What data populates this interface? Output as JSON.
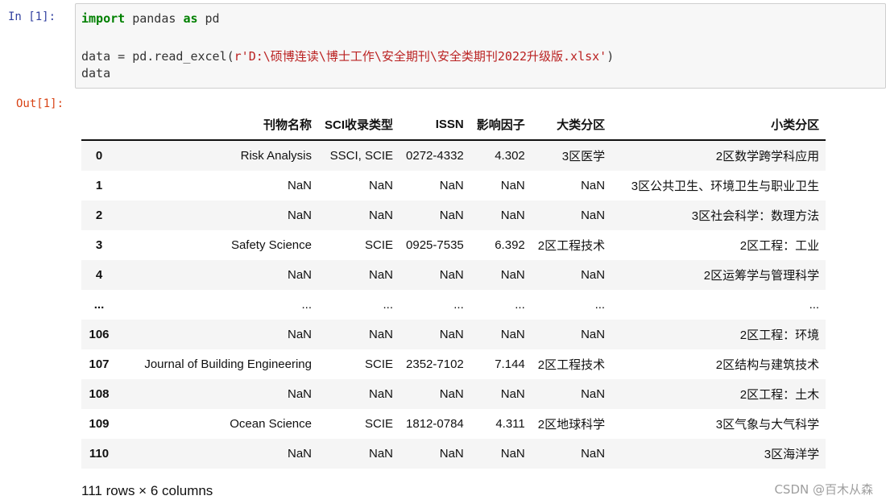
{
  "notebook": {
    "in_prompt": "In  [1]:",
    "out_prompt": "Out[1]:",
    "code": {
      "line1": {
        "kw1": "import",
        "mid": " pandas ",
        "kw2": "as",
        "end": " pd"
      },
      "line2": {
        "pre": "data = pd.read_excel(",
        "str": "r'D:\\硕博连读\\博士工作\\安全期刊\\安全类期刊2022升级版.xlsx'",
        "post": ")"
      },
      "line3": "data"
    }
  },
  "dataframe": {
    "columns": [
      "刊物名称",
      "SCI收录类型",
      "ISSN",
      "影响因子",
      "大类分区",
      "小类分区"
    ],
    "rows": [
      {
        "index": "0",
        "cells": [
          "Risk Analysis",
          "SSCI, SCIE",
          "0272-4332",
          "4.302",
          "3区医学",
          "2区数学跨学科应用"
        ]
      },
      {
        "index": "1",
        "cells": [
          "NaN",
          "NaN",
          "NaN",
          "NaN",
          "NaN",
          "3区公共卫生、环境卫生与职业卫生"
        ]
      },
      {
        "index": "2",
        "cells": [
          "NaN",
          "NaN",
          "NaN",
          "NaN",
          "NaN",
          "3区社会科学：数理方法"
        ]
      },
      {
        "index": "3",
        "cells": [
          "Safety Science",
          "SCIE",
          "0925-7535",
          "6.392",
          "2区工程技术",
          "2区工程：工业"
        ]
      },
      {
        "index": "4",
        "cells": [
          "NaN",
          "NaN",
          "NaN",
          "NaN",
          "NaN",
          "2区运筹学与管理科学"
        ]
      },
      {
        "index": "...",
        "cells": [
          "...",
          "...",
          "...",
          "...",
          "...",
          "..."
        ]
      },
      {
        "index": "106",
        "cells": [
          "NaN",
          "NaN",
          "NaN",
          "NaN",
          "NaN",
          "2区工程：环境"
        ]
      },
      {
        "index": "107",
        "cells": [
          "Journal of Building Engineering",
          "SCIE",
          "2352-7102",
          "7.144",
          "2区工程技术",
          "2区结构与建筑技术"
        ]
      },
      {
        "index": "108",
        "cells": [
          "NaN",
          "NaN",
          "NaN",
          "NaN",
          "NaN",
          "2区工程：土木"
        ]
      },
      {
        "index": "109",
        "cells": [
          "Ocean Science",
          "SCIE",
          "1812-0784",
          "4.311",
          "2区地球科学",
          "3区气象与大气科学"
        ]
      },
      {
        "index": "110",
        "cells": [
          "NaN",
          "NaN",
          "NaN",
          "NaN",
          "NaN",
          "3区海洋学"
        ]
      }
    ],
    "shape_text": "111 rows × 6 columns"
  },
  "watermark": "CSDN @百木从森"
}
